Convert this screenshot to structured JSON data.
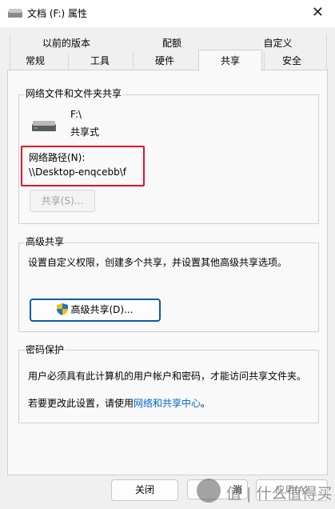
{
  "window": {
    "title": "文档 (F:) 属性",
    "close_glyph": "✕"
  },
  "tabs": {
    "row1": [
      "以前的版本",
      "配额",
      "自定义"
    ],
    "row2": [
      "常规",
      "工具",
      "硬件",
      "共享",
      "安全"
    ]
  },
  "network_sharing": {
    "group_title": "网络文件和文件夹共享",
    "path_letter": "F:\\",
    "share_state": "共享式",
    "network_path_label": "网络路径(N):",
    "network_path_value": "\\\\Desktop-enqcebb\\f",
    "share_button": "共享(S)..."
  },
  "advanced_sharing": {
    "group_title": "高级共享",
    "description": "设置自定义权限，创建多个共享，并设置其他高级共享选项。",
    "button": "高级共享(D)..."
  },
  "password_protection": {
    "group_title": "密码保护",
    "description": "用户必须具有此计算机的用户帐户和密码，才能访问共享文件夹。",
    "change_prefix": "若要更改此设置，请使用",
    "change_link": "网络和共享中心",
    "change_suffix": "。"
  },
  "footer": {
    "close_button": "关闭",
    "cancel_partial": "消",
    "apply_partial": "应用(A)"
  },
  "watermark": {
    "text": "值 | 什么值得买"
  },
  "colors": {
    "highlight_border": "#e81123",
    "link": "#0066cc",
    "focus_border": "#0a5ab4"
  }
}
